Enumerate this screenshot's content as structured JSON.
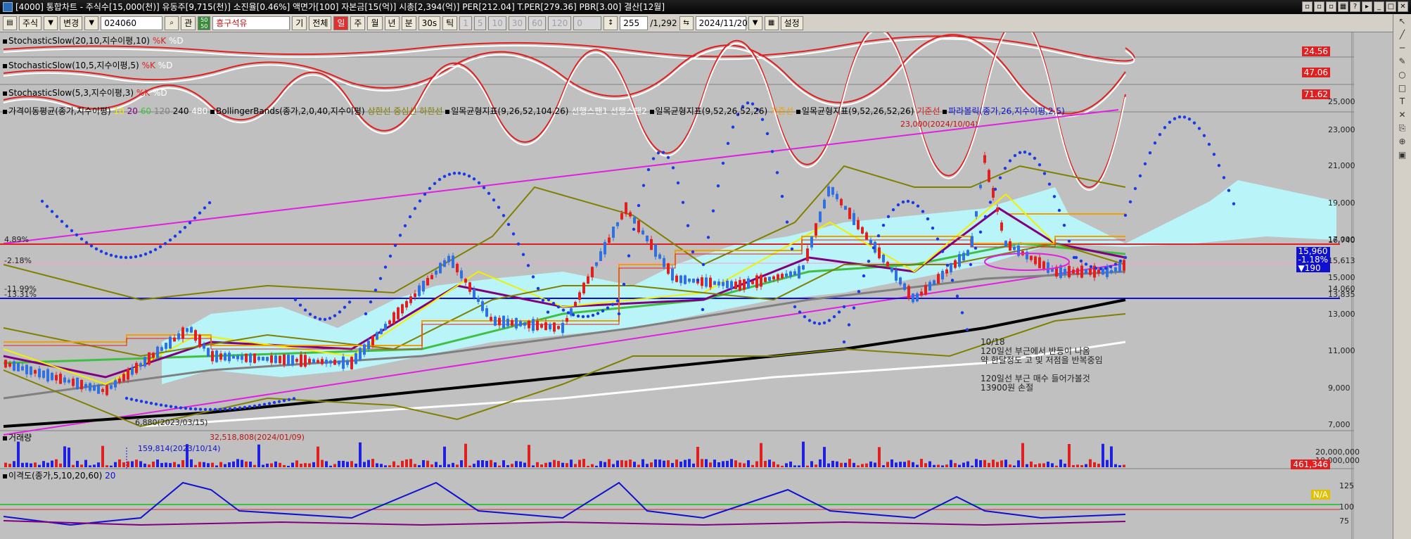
{
  "title": "[4000] 통합차트 - 주식수[15,000(천)] 유동주[9,715(천)] 소진율[0.46%] 액면가[100] 자본금[15(억)] 시총[2,394(억)] PER[212.04] T.PER[279.36] PBR[3.00] 결산[12월]",
  "toolbar": {
    "market": "주식",
    "change_label": "변경",
    "code": "024060",
    "gwan": "관",
    "badge_top": "50",
    "badge_bottom": "50",
    "stock_name": "흥구석유",
    "gi": "기",
    "all": "전체",
    "periods": [
      "일",
      "주",
      "월",
      "년",
      "분",
      "30s",
      "틱"
    ],
    "intervals": [
      "1",
      "5",
      "10",
      "30",
      "60",
      "120",
      "0"
    ],
    "count": "255",
    "total": "/1,292",
    "date": "2024/11/20",
    "settings": "설정"
  },
  "legends": {
    "stoch1": "StochasticSlow(20,10,지수이평,10)",
    "stoch2": "StochasticSlow(10,5,지수이평,5)",
    "stoch3": "StochasticSlow(5,3,지수이평,3)",
    "k": "%K",
    "d": "%D",
    "ma": "가격이동평균(종가,지수이평)",
    "ma_periods": [
      "10",
      "20",
      "60",
      "120",
      "240",
      "480"
    ],
    "bb": "BollingerBands(종가,2,0,40,지수이평)",
    "bb_bands": "상한선 중심선 하한선",
    "ichi1": "일목균형지표(9,26,52,104,26)",
    "ichi1_lines": "선행스팬1 선행스팬2",
    "ichi2": "일목균형지표(9,52,26,52,26)",
    "ichi2_line": "기준선",
    "ichi3": "일목균형지표(9,52,26,52,26)",
    "ichi3_line": "기준선",
    "para": "파라볼릭(종가,26,지수이평,2,5)",
    "volume": "거래량",
    "disparity": "이격도(종가,5,10,20,60)",
    "disparity_period": "20"
  },
  "scales": {
    "stoch1_value": "24.56",
    "stoch2_value": "47.06",
    "stoch3_value": "71.62",
    "price_ticks": [
      "25,000",
      "23,000",
      "21,000",
      "19,000",
      "17,000",
      "15,000",
      "13,000",
      "11,000",
      "9,000",
      "7,000"
    ],
    "level_16740": "16,740",
    "level_15613": "15,613",
    "level_14060": "14,060",
    "level_13835": "13,835",
    "current_price": "15,960",
    "current_change": "-1.18%",
    "current_diff": "▼190",
    "volume_ticks": [
      "20,000,000",
      "10,000,000"
    ],
    "volume_value": "461,346",
    "disparity_ticks": [
      "125",
      "100",
      "75"
    ],
    "disparity_value": "N/A"
  },
  "left_labels": {
    "pct1": "4.89%",
    "pct2": "-2.18%",
    "pct3": "-11.99%",
    "pct4": "-13.31%"
  },
  "annotations": {
    "high": "23,000(2024/10/04)",
    "low": "6,880(2023/03/15)",
    "vol_high": "32,518,808(2024/01/09)",
    "vol_mark": "159,814(2023/10/14)",
    "note_lines": [
      "10/18",
      "120일선 부근에서 반등이 나옴",
      "약 한달정도 고 및 저점을 반복중임",
      "",
      "120일선 부근 매수 들어가볼것",
      "13900원 손절"
    ]
  },
  "colors": {
    "background": "#c0c0c0",
    "up": "#e02020",
    "down": "#2020e0",
    "cloud": "#b8f4f8",
    "trend": "#e020e0",
    "parabolic": "#1a3ae8"
  }
}
